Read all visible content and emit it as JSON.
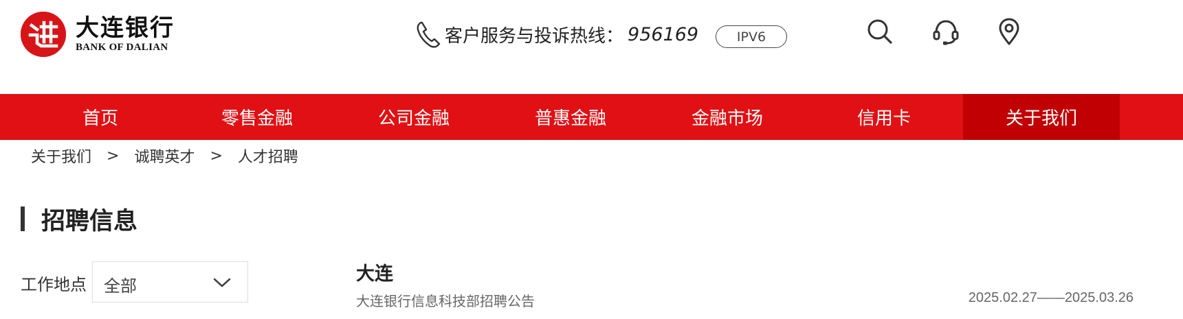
{
  "header": {
    "logo_cn": "大连银行",
    "logo_en": "BANK OF DALIAN",
    "hotline_label": "客户服务与投诉热线：",
    "hotline_number": "956169",
    "ipv6_label": "IPV6"
  },
  "nav": {
    "items": [
      {
        "label": "首页"
      },
      {
        "label": "零售金融"
      },
      {
        "label": "公司金融"
      },
      {
        "label": "普惠金融"
      },
      {
        "label": "金融市场"
      },
      {
        "label": "信用卡"
      },
      {
        "label": "关于我们"
      }
    ],
    "active_index": 6
  },
  "breadcrumb": {
    "items": [
      "关于我们",
      "诚聘英才",
      "人才招聘"
    ],
    "separator": ">"
  },
  "section": {
    "title": "招聘信息"
  },
  "filter": {
    "label": "工作地点",
    "selected": "全部"
  },
  "jobs": [
    {
      "city": "大连",
      "title": "大连银行信息科技部招聘公告",
      "date_range": "2025.02.27——2025.03.26"
    }
  ],
  "colors": {
    "brand_red": "#e01014",
    "active_red": "#c00003",
    "logo_red": "#d71518"
  },
  "icons": {
    "logo": "bank-logo-icon",
    "phone": "phone-icon",
    "search": "search-icon",
    "service": "headset-icon",
    "location": "location-pin-icon",
    "dropdown": "chevron-down-icon"
  }
}
